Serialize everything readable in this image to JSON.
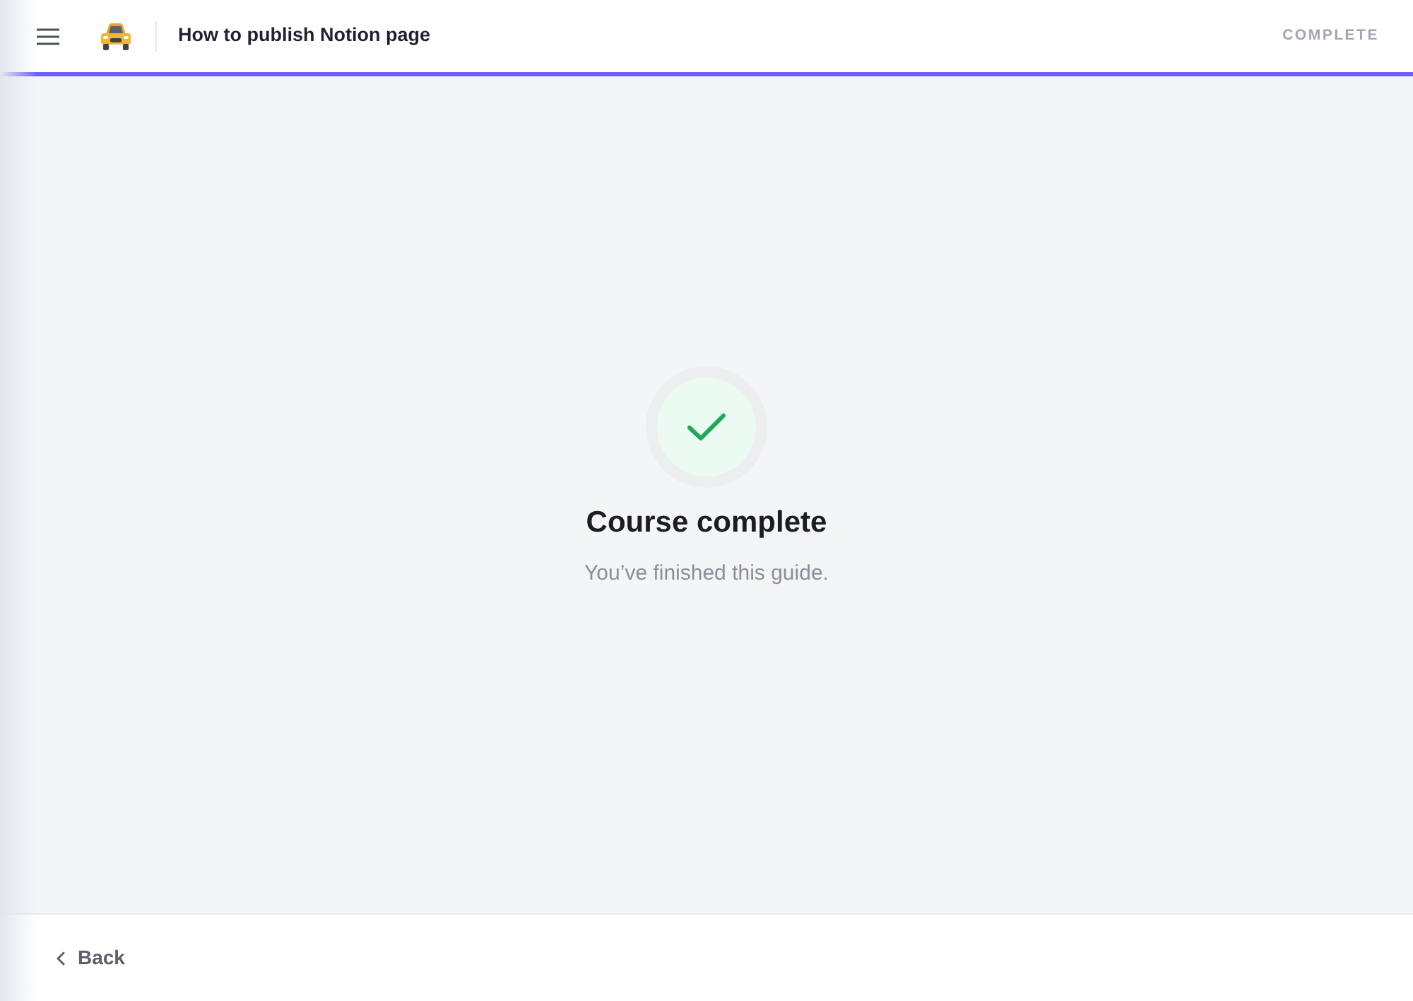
{
  "header": {
    "title": "How to publish Notion page",
    "status": "COMPLETE"
  },
  "progress": {
    "level": 1
  },
  "completion": {
    "title": "Course complete",
    "message": "You’ve finished this guide."
  },
  "footer": {
    "back_button": "Back"
  }
}
